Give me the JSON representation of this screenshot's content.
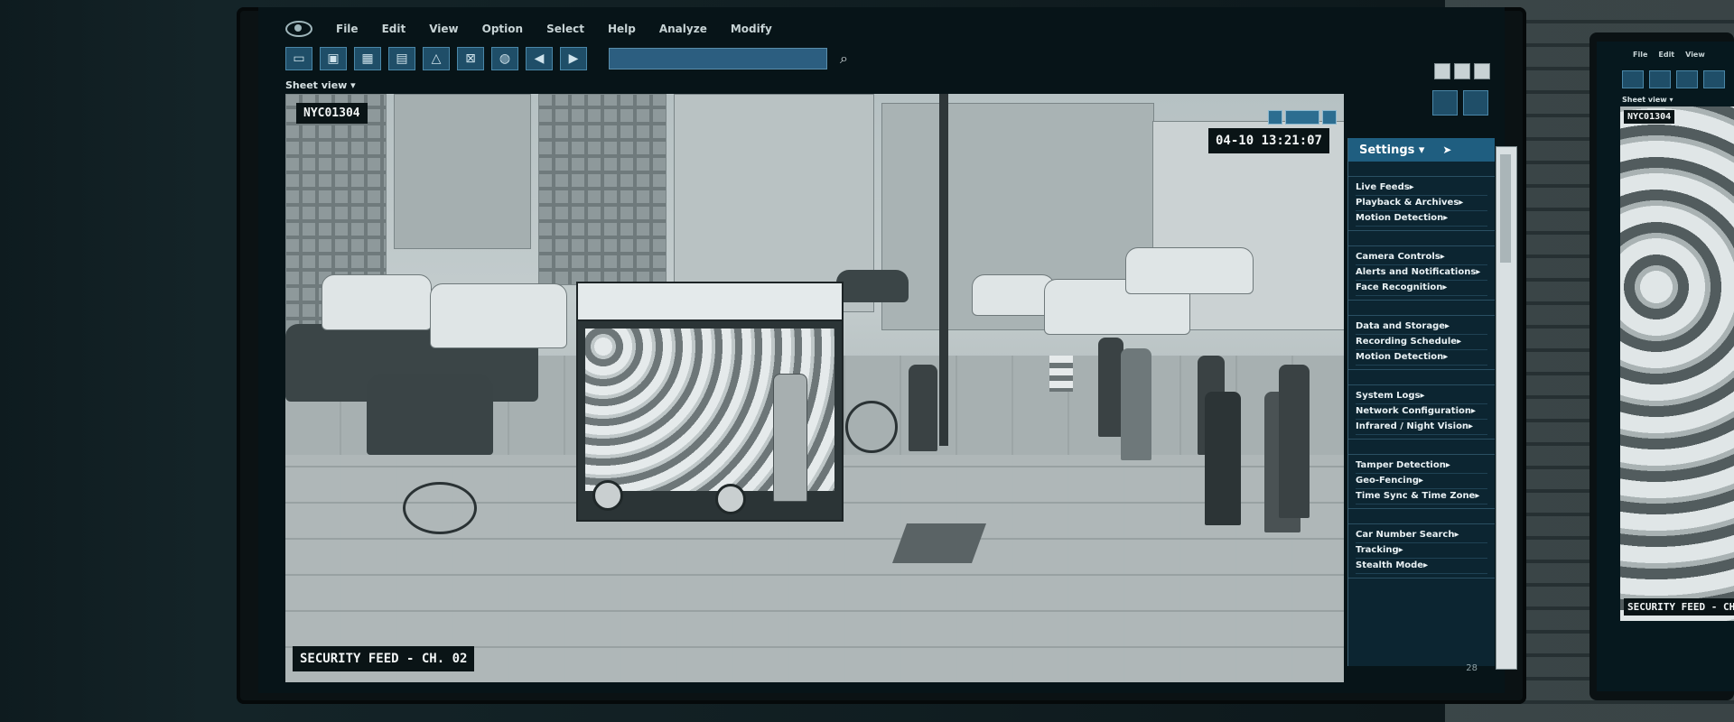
{
  "menu": {
    "items": [
      "File",
      "Edit",
      "View",
      "Option",
      "Select",
      "Help",
      "Analyze",
      "Modify"
    ]
  },
  "toolbar": {
    "icons": [
      "layout-icon",
      "camera-icon",
      "grid-icon",
      "document-icon",
      "triangle-icon",
      "select-icon",
      "globe-icon",
      "arrow-left-icon",
      "arrow-right-icon"
    ],
    "search_value": ""
  },
  "sheet_view": {
    "label": "Sheet view ▾"
  },
  "feed": {
    "camera_id": "NYC01304",
    "timestamp": "04-10 13:21:07",
    "channel_label": "SECURITY FEED - CH. 02"
  },
  "settings_panel": {
    "title": "Settings ▾",
    "groups": [
      [
        "Live Feeds▸",
        "Playback & Archives▸",
        "Motion Detection▸"
      ],
      [
        "Camera Controls▸",
        "Alerts and Notifications▸",
        "Face Recognition▸"
      ],
      [
        "Data and Storage▸",
        "Recording Schedule▸",
        "Motion Detection▸"
      ],
      [
        "System Logs▸",
        "Network Configuration▸",
        "Infrared / Night Vision▸"
      ],
      [
        "Tamper Detection▸",
        "Geo-Fencing▸",
        "Time Sync & Time Zone▸"
      ],
      [
        "Car Number Search▸",
        "Tracking▸",
        "Stealth Mode▸"
      ]
    ]
  },
  "corner_number": "28",
  "second_monitor": {
    "menu": [
      "File",
      "Edit",
      "View"
    ],
    "camera_id": "NYC01304",
    "channel_label": "SECURITY FEED - CH."
  }
}
